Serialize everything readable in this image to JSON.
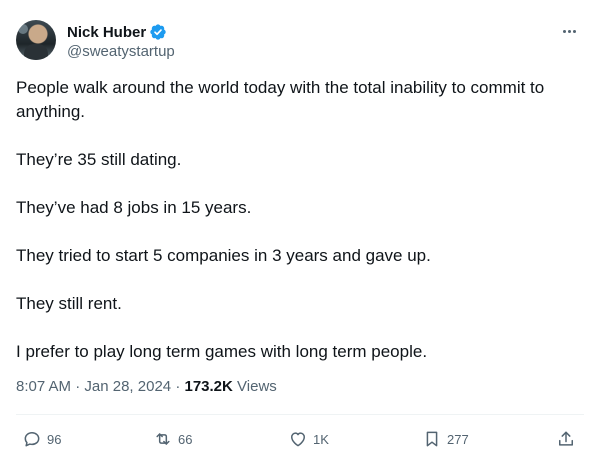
{
  "author": {
    "display_name": "Nick Huber",
    "handle": "@sweatystartup",
    "verified": true,
    "avatar_icon": "profile-photo"
  },
  "tweet": {
    "paragraphs": [
      "People walk around the world today with the total inability to commit to anything.",
      "They’re 35 still dating.",
      "They’ve had 8 jobs in 15 years.",
      "They tried to start 5 companies in 3 years and gave up.",
      "They still rent.",
      "I prefer to play long term games with long term people."
    ],
    "time": "8:07 AM",
    "date": "Jan 28, 2024",
    "separator": "·",
    "views_count": "173.2K",
    "views_label": "Views"
  },
  "actions": {
    "replies": "96",
    "reposts": "66",
    "likes": "1K",
    "bookmarks": "277"
  },
  "colors": {
    "text": "#0f1419",
    "secondary": "#536471",
    "verified": "#1d9bf0",
    "divider": "#eff3f4"
  }
}
